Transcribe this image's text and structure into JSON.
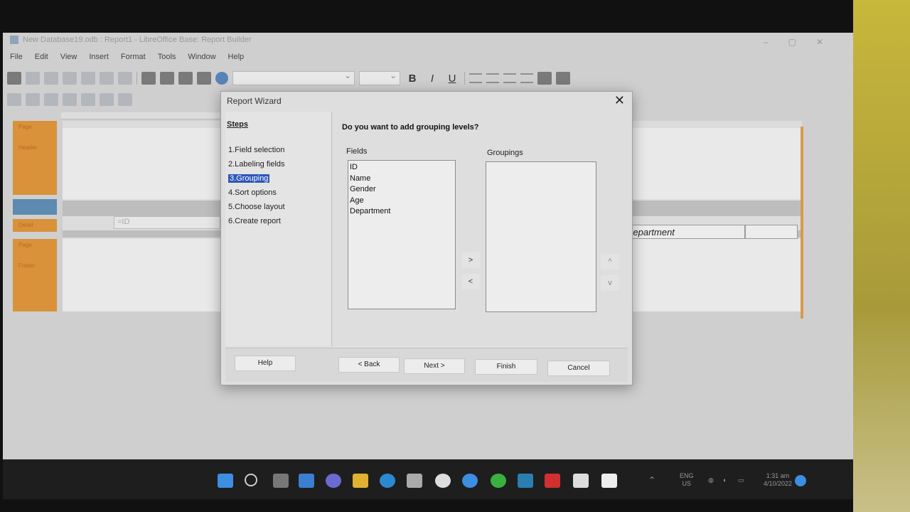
{
  "app": {
    "title": "New Database19.odb : Report1 - LibreOffice Base: Report Builder"
  },
  "menubar": [
    "File",
    "Edit",
    "View",
    "Insert",
    "Format",
    "Tools",
    "Window",
    "Help"
  ],
  "format_buttons": {
    "bold": "B",
    "italic": "I",
    "underline": "U"
  },
  "report_sections": [
    "Page",
    "Header",
    "",
    "Detail",
    "Page",
    "Footer"
  ],
  "canvas": {
    "id_field": "=ID",
    "department_field": "Department"
  },
  "dialog": {
    "title": "Report Wizard",
    "close_glyph": "✕",
    "steps_heading": "Steps",
    "steps": [
      "1.Field selection",
      "2.Labeling fields",
      "3.Grouping",
      "4.Sort options",
      "5.Choose layout",
      "6.Create report"
    ],
    "active_step_index": 2,
    "question": "Do you want to add grouping levels?",
    "fields_label": "Fields",
    "groupings_label": "Groupings",
    "fields": [
      "ID",
      "Name",
      "Gender",
      "Age",
      "Department"
    ],
    "groupings": [],
    "add_arrow": ">",
    "remove_arrow": "<",
    "up_arrow": "^",
    "down_arrow": "v",
    "buttons": {
      "help": "Help",
      "back": "< Back",
      "next": "Next >",
      "finish": "Finish",
      "cancel": "Cancel"
    }
  },
  "tray": {
    "lang": "ENG",
    "region": "US",
    "time": "1:31 am",
    "date": "4/10/2022"
  }
}
